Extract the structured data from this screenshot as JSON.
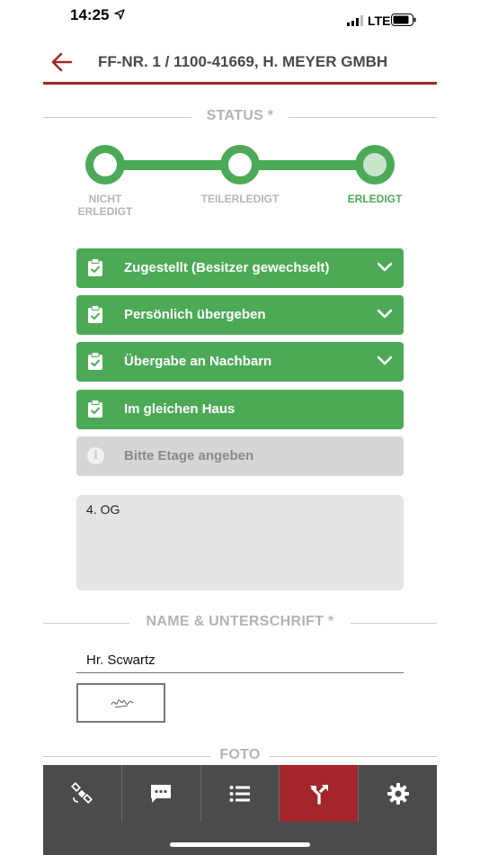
{
  "statusbar": {
    "time": "14:25",
    "network": "LTE"
  },
  "header": {
    "title": "FF-NR. 1 / 1100-41669, H. MEYER GMBH"
  },
  "status_section": {
    "title": "STATUS *"
  },
  "stepper": {
    "steps": [
      {
        "label": "NICHT\nERLEDIGT",
        "active": false
      },
      {
        "label": "TEILERLEDIGT",
        "active": false
      },
      {
        "label": "ERLEDIGT",
        "active": true
      }
    ]
  },
  "options": [
    {
      "label": "Zugestellt (Besitzer gewechselt)",
      "expandable": true
    },
    {
      "label": "Persönlich übergeben",
      "expandable": true
    },
    {
      "label": "Übergabe an Nachbarn",
      "expandable": true
    },
    {
      "label": "Im gleichen Haus",
      "expandable": false
    }
  ],
  "hint": {
    "label": "Bitte Etage angeben"
  },
  "notes": {
    "value": "4. OG"
  },
  "name_section": {
    "title": "NAME & UNTERSCHRIFT *"
  },
  "name_input": {
    "value": "Hr. Scwartz"
  },
  "foto_section": {
    "title": "FOTO"
  },
  "colors": {
    "accent": "#a3262d",
    "success": "#4caa57",
    "nav_bg": "#4b4b4b"
  },
  "bottom_nav": [
    {
      "icon": "satellite-icon",
      "active": false
    },
    {
      "icon": "chat-icon",
      "active": false
    },
    {
      "icon": "list-icon",
      "active": false
    },
    {
      "icon": "route-icon",
      "active": true
    },
    {
      "icon": "gear-icon",
      "active": false
    }
  ]
}
